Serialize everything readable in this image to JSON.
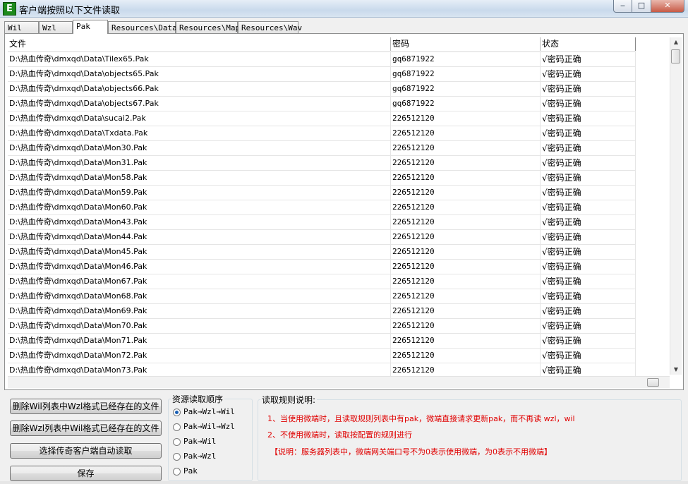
{
  "window": {
    "title": "客户端按照以下文件读取",
    "app_icon": "E",
    "min_label": "‒",
    "max_label": "□",
    "close_label": "✕"
  },
  "tabs": [
    {
      "label": "Wil"
    },
    {
      "label": "Wzl"
    },
    {
      "label": "Pak"
    },
    {
      "label": "Resources\\Data"
    },
    {
      "label": "Resources\\Map"
    },
    {
      "label": "Resources\\Wav"
    }
  ],
  "active_tab": "Pak",
  "table": {
    "headers": [
      "文件",
      "密码",
      "状态"
    ],
    "rows": [
      {
        "file": "D:\\热血传奇\\dmxqd\\Data\\Tilex65.Pak",
        "password": "gq6871922",
        "status": "√密码正确"
      },
      {
        "file": "D:\\热血传奇\\dmxqd\\Data\\objects65.Pak",
        "password": "gq6871922",
        "status": "√密码正确"
      },
      {
        "file": "D:\\热血传奇\\dmxqd\\Data\\objects66.Pak",
        "password": "gq6871922",
        "status": "√密码正确"
      },
      {
        "file": "D:\\热血传奇\\dmxqd\\Data\\objects67.Pak",
        "password": "gq6871922",
        "status": "√密码正确"
      },
      {
        "file": "D:\\热血传奇\\dmxqd\\Data\\sucai2.Pak",
        "password": "226512120",
        "status": "√密码正确"
      },
      {
        "file": "D:\\热血传奇\\dmxqd\\Data\\Txdata.Pak",
        "password": "226512120",
        "status": "√密码正确"
      },
      {
        "file": "D:\\热血传奇\\dmxqd\\Data\\Mon30.Pak",
        "password": "226512120",
        "status": "√密码正确"
      },
      {
        "file": "D:\\热血传奇\\dmxqd\\Data\\Mon31.Pak",
        "password": "226512120",
        "status": "√密码正确"
      },
      {
        "file": "D:\\热血传奇\\dmxqd\\Data\\Mon58.Pak",
        "password": "226512120",
        "status": "√密码正确"
      },
      {
        "file": "D:\\热血传奇\\dmxqd\\Data\\Mon59.Pak",
        "password": "226512120",
        "status": "√密码正确"
      },
      {
        "file": "D:\\热血传奇\\dmxqd\\Data\\Mon60.Pak",
        "password": "226512120",
        "status": "√密码正确"
      },
      {
        "file": "D:\\热血传奇\\dmxqd\\Data\\Mon43.Pak",
        "password": "226512120",
        "status": "√密码正确"
      },
      {
        "file": "D:\\热血传奇\\dmxqd\\Data\\Mon44.Pak",
        "password": "226512120",
        "status": "√密码正确"
      },
      {
        "file": "D:\\热血传奇\\dmxqd\\Data\\Mon45.Pak",
        "password": "226512120",
        "status": "√密码正确"
      },
      {
        "file": "D:\\热血传奇\\dmxqd\\Data\\Mon46.Pak",
        "password": "226512120",
        "status": "√密码正确"
      },
      {
        "file": "D:\\热血传奇\\dmxqd\\Data\\Mon67.Pak",
        "password": "226512120",
        "status": "√密码正确"
      },
      {
        "file": "D:\\热血传奇\\dmxqd\\Data\\Mon68.Pak",
        "password": "226512120",
        "status": "√密码正确"
      },
      {
        "file": "D:\\热血传奇\\dmxqd\\Data\\Mon69.Pak",
        "password": "226512120",
        "status": "√密码正确"
      },
      {
        "file": "D:\\热血传奇\\dmxqd\\Data\\Mon70.Pak",
        "password": "226512120",
        "status": "√密码正确"
      },
      {
        "file": "D:\\热血传奇\\dmxqd\\Data\\Mon71.Pak",
        "password": "226512120",
        "status": "√密码正确"
      },
      {
        "file": "D:\\热血传奇\\dmxqd\\Data\\Mon72.Pak",
        "password": "226512120",
        "status": "√密码正确"
      },
      {
        "file": "D:\\热血传奇\\dmxqd\\Data\\Mon73.Pak",
        "password": "226512120",
        "status": "√密码正确"
      }
    ]
  },
  "scroll_arrows": {
    "up": "▲",
    "down": "▼"
  },
  "buttons": {
    "delete_wil": "删除Wil列表中Wzl格式已经存在的文件",
    "delete_wzl": "删除Wzl列表中Wil格式已经存在的文件",
    "select_client": "选择传奇客户端自动读取",
    "save": "保存"
  },
  "order_group": {
    "title": "资源读取顺序",
    "options": [
      {
        "label": "Pak→Wzl→Wil",
        "checked": true
      },
      {
        "label": "Pak→Wil→Wzl",
        "checked": false
      },
      {
        "label": "Pak→Wil",
        "checked": false
      },
      {
        "label": "Pak→Wzl",
        "checked": false
      },
      {
        "label": "Pak",
        "checked": false
      }
    ]
  },
  "rules_group": {
    "title": "读取规则说明:",
    "rule1": "1、当使用微端时，且读取规则列表中有pak，微端直接请求更新pak，而不再读 wzl，wil",
    "rule2": "2、不使用微端时，读取按配置的规则进行",
    "note": "【说明：服务器列表中，微端网关端口号不为0表示使用微端，为0表示不用微端】",
    "text_color": "#e00000"
  }
}
